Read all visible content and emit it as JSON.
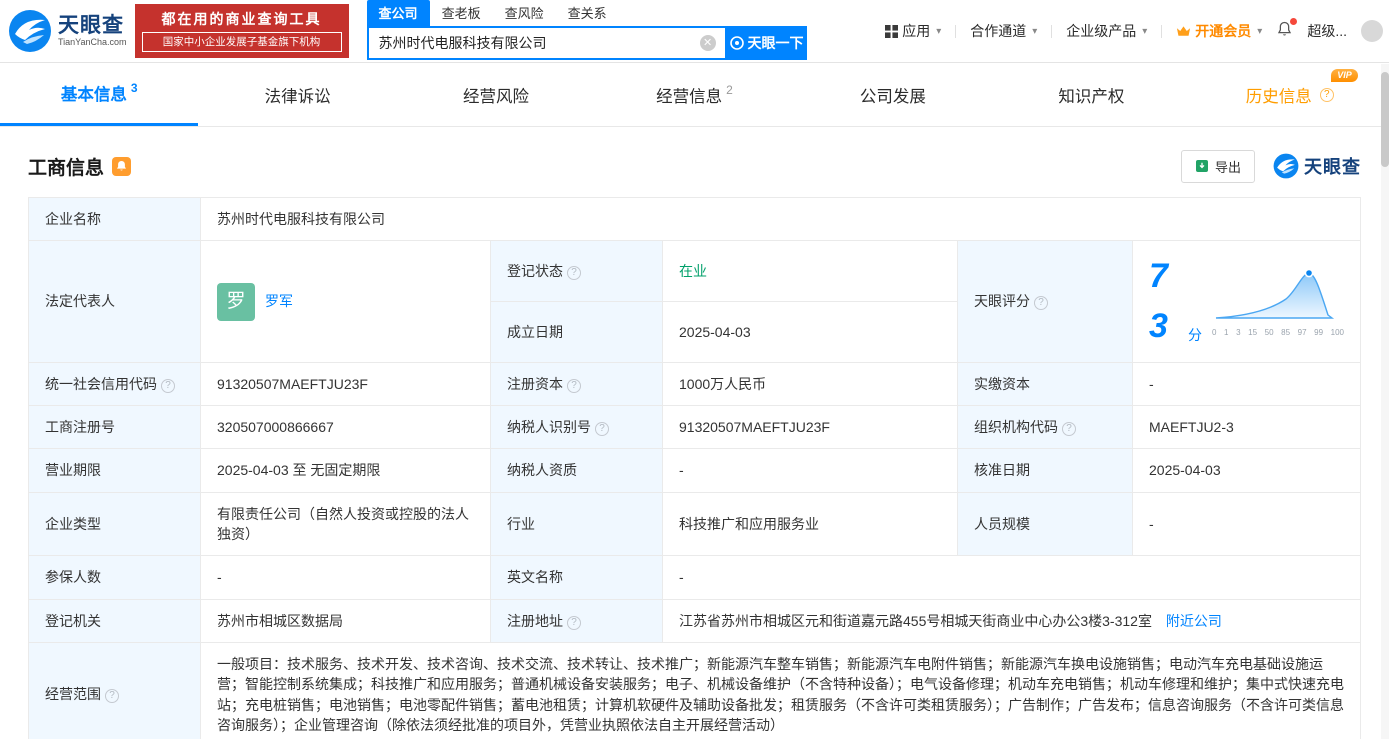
{
  "header": {
    "logo": {
      "cn": "天眼查",
      "en": "TianYanCha.com"
    },
    "banner": {
      "line1": "都在用的商业查询工具",
      "line2": "国家中小企业发展子基金旗下机构"
    },
    "search_tabs": [
      {
        "label": "查公司"
      },
      {
        "label": "查老板"
      },
      {
        "label": "查风险"
      },
      {
        "label": "查关系"
      }
    ],
    "search": {
      "value": "苏州时代电服科技有限公司",
      "button": "天眼一下"
    },
    "nav": {
      "apps": "应用",
      "partner": "合作通道",
      "enterprise": "企业级产品",
      "vip": "开通会员",
      "super": "超级..."
    }
  },
  "tabs": {
    "basic": {
      "label": "基本信息",
      "badge": "3"
    },
    "legal": {
      "label": "法律诉讼"
    },
    "risk": {
      "label": "经营风险"
    },
    "operation": {
      "label": "经营信息",
      "badge": "2"
    },
    "development": {
      "label": "公司发展"
    },
    "ip": {
      "label": "知识产权"
    },
    "history": {
      "label": "历史信息",
      "vip_tag": "VIP"
    }
  },
  "section": {
    "title": "工商信息",
    "export_label": "导出",
    "brand": "天眼查"
  },
  "info": {
    "company_name": {
      "label": "企业名称",
      "value": "苏州时代电服科技有限公司"
    },
    "legal_rep": {
      "label": "法定代表人",
      "avatar": "罗",
      "value": "罗军"
    },
    "reg_status": {
      "label": "登记状态",
      "value": "在业"
    },
    "establish_date": {
      "label": "成立日期",
      "value": "2025-04-03"
    },
    "score": {
      "label": "天眼评分",
      "value": "73",
      "unit": "分",
      "axis": [
        "0",
        "1",
        "3",
        "15",
        "50",
        "85",
        "97",
        "99",
        "100"
      ]
    },
    "credit_code": {
      "label": "统一社会信用代码",
      "value": "91320507MAEFTJU23F"
    },
    "reg_capital": {
      "label": "注册资本",
      "value": "1000万人民币"
    },
    "paid_capital": {
      "label": "实缴资本",
      "value": "-"
    },
    "reg_number": {
      "label": "工商注册号",
      "value": "320507000866667"
    },
    "taxpayer_id": {
      "label": "纳税人识别号",
      "value": "91320507MAEFTJU23F"
    },
    "org_code": {
      "label": "组织机构代码",
      "value": "MAEFTJU2-3"
    },
    "business_term": {
      "label": "营业期限",
      "value": "2025-04-03 至 无固定期限"
    },
    "taxpayer_quality": {
      "label": "纳税人资质",
      "value": "-"
    },
    "approval_date": {
      "label": "核准日期",
      "value": "2025-04-03"
    },
    "company_type": {
      "label": "企业类型",
      "value": "有限责任公司（自然人投资或控股的法人独资）"
    },
    "industry": {
      "label": "行业",
      "value": "科技推广和应用服务业"
    },
    "staff_size": {
      "label": "人员规模",
      "value": "-"
    },
    "insured_count": {
      "label": "参保人数",
      "value": "-"
    },
    "english_name": {
      "label": "英文名称",
      "value": "-"
    },
    "reg_authority": {
      "label": "登记机关",
      "value": "苏州市相城区数据局"
    },
    "reg_address": {
      "label": "注册地址",
      "value": "江苏省苏州市相城区元和街道嘉元路455号相城天街商业中心办公3楼3-312室",
      "link": "附近公司"
    },
    "business_scope": {
      "label": "经营范围",
      "value": "一般项目：技术服务、技术开发、技术咨询、技术交流、技术转让、技术推广；新能源汽车整车销售；新能源汽车电附件销售；新能源汽车换电设施销售；电动汽车充电基础设施运营；智能控制系统集成；科技推广和应用服务；普通机械设备安装服务；电子、机械设备维护（不含特种设备）；电气设备修理；机动车充电销售；机动车修理和维护；集中式快速充电站；充电桩销售；电池销售；电池零配件销售；蓄电池租赁；计算机软硬件及辅助设备批发；租赁服务（不含许可类租赁服务）；广告制作；广告发布；信息咨询服务（不含许可类信息咨询服务）；企业管理咨询（除依法须经批准的项目外，凭营业执照依法自主开展经营活动）"
    }
  }
}
